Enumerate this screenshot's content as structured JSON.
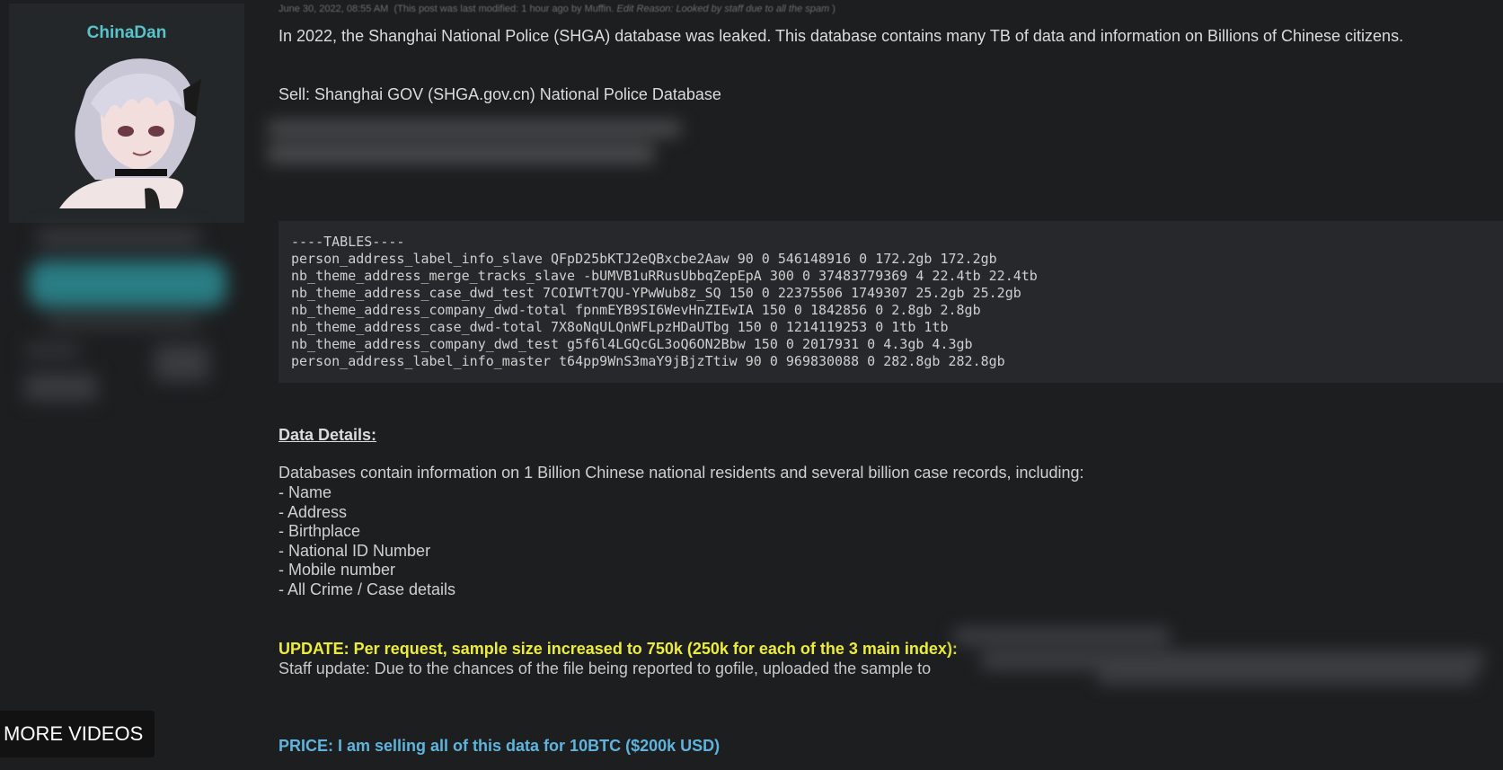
{
  "profile": {
    "username": "ChinaDan",
    "accent_color": "#59c3ca"
  },
  "post": {
    "meta": {
      "date": "June 30, 2022, 08:55 AM",
      "modified_note": "(This post was last modified: 1 hour ago by Muffin.",
      "edit_reason": "Edit Reason: Looked by staff due to all the spam",
      "close": ")"
    },
    "intro": "In 2022, the Shanghai National Police (SHGA) database was leaked. This database contains many TB of data and information on Billions of Chinese citizens.",
    "sell_line": "Sell: Shanghai GOV (SHGA.gov.cn) National Police Database",
    "tables_header": "----TABLES----",
    "tables": [
      "person_address_label_info_slave QFpD25bKTJ2eQBxcbe2Aaw 90 0 546148916 0 172.2gb 172.2gb",
      "nb_theme_address_merge_tracks_slave -bUMVB1uRRusUbbqZepEpA 300 0 37483779369 4 22.4tb 22.4tb",
      "nb_theme_address_case_dwd_test 7COIWTt7QU-YPwWub8z_SQ 150 0 22375506 1749307 25.2gb 25.2gb",
      "nb_theme_address_company_dwd-total fpnmEYB9SI6WevHnZIEwIA 150 0 1842856 0 2.8gb 2.8gb",
      "nb_theme_address_case_dwd-total 7X8oNqULQnWFLpzHDaUTbg 150 0 1214119253 0 1tb 1tb",
      "nb_theme_address_company_dwd_test g5f6l4LGQcGL3oQ6ON2Bbw 150 0 2017931 0 4.3gb 4.3gb",
      "person_address_label_info_master t64pp9WnS3maY9jBjzTtiw 90 0 969830088 0 282.8gb 282.8gb"
    ],
    "details_heading": "Data Details:",
    "details_intro": "Databases contain information on 1 Billion Chinese national residents and several billion case records, including:",
    "details_items": [
      "- Name",
      "- Address",
      "- Birthplace",
      "- National ID Number",
      "- Mobile number",
      "- All Crime / Case details"
    ],
    "update": "UPDATE: Per request, sample size increased to 750k (250k for each of the 3 main index):",
    "staff_update": "Staff update: Due to the chances of the file being reported to gofile, uploaded the sample to",
    "price": "PRICE: I am selling all of this data for 10BTC ($200k USD)",
    "colors": {
      "update": "#ecec3f",
      "price": "#5fb4dd",
      "code_background": "#27282b"
    }
  },
  "overlay": {
    "more_videos_label": "MORE VIDEOS"
  }
}
